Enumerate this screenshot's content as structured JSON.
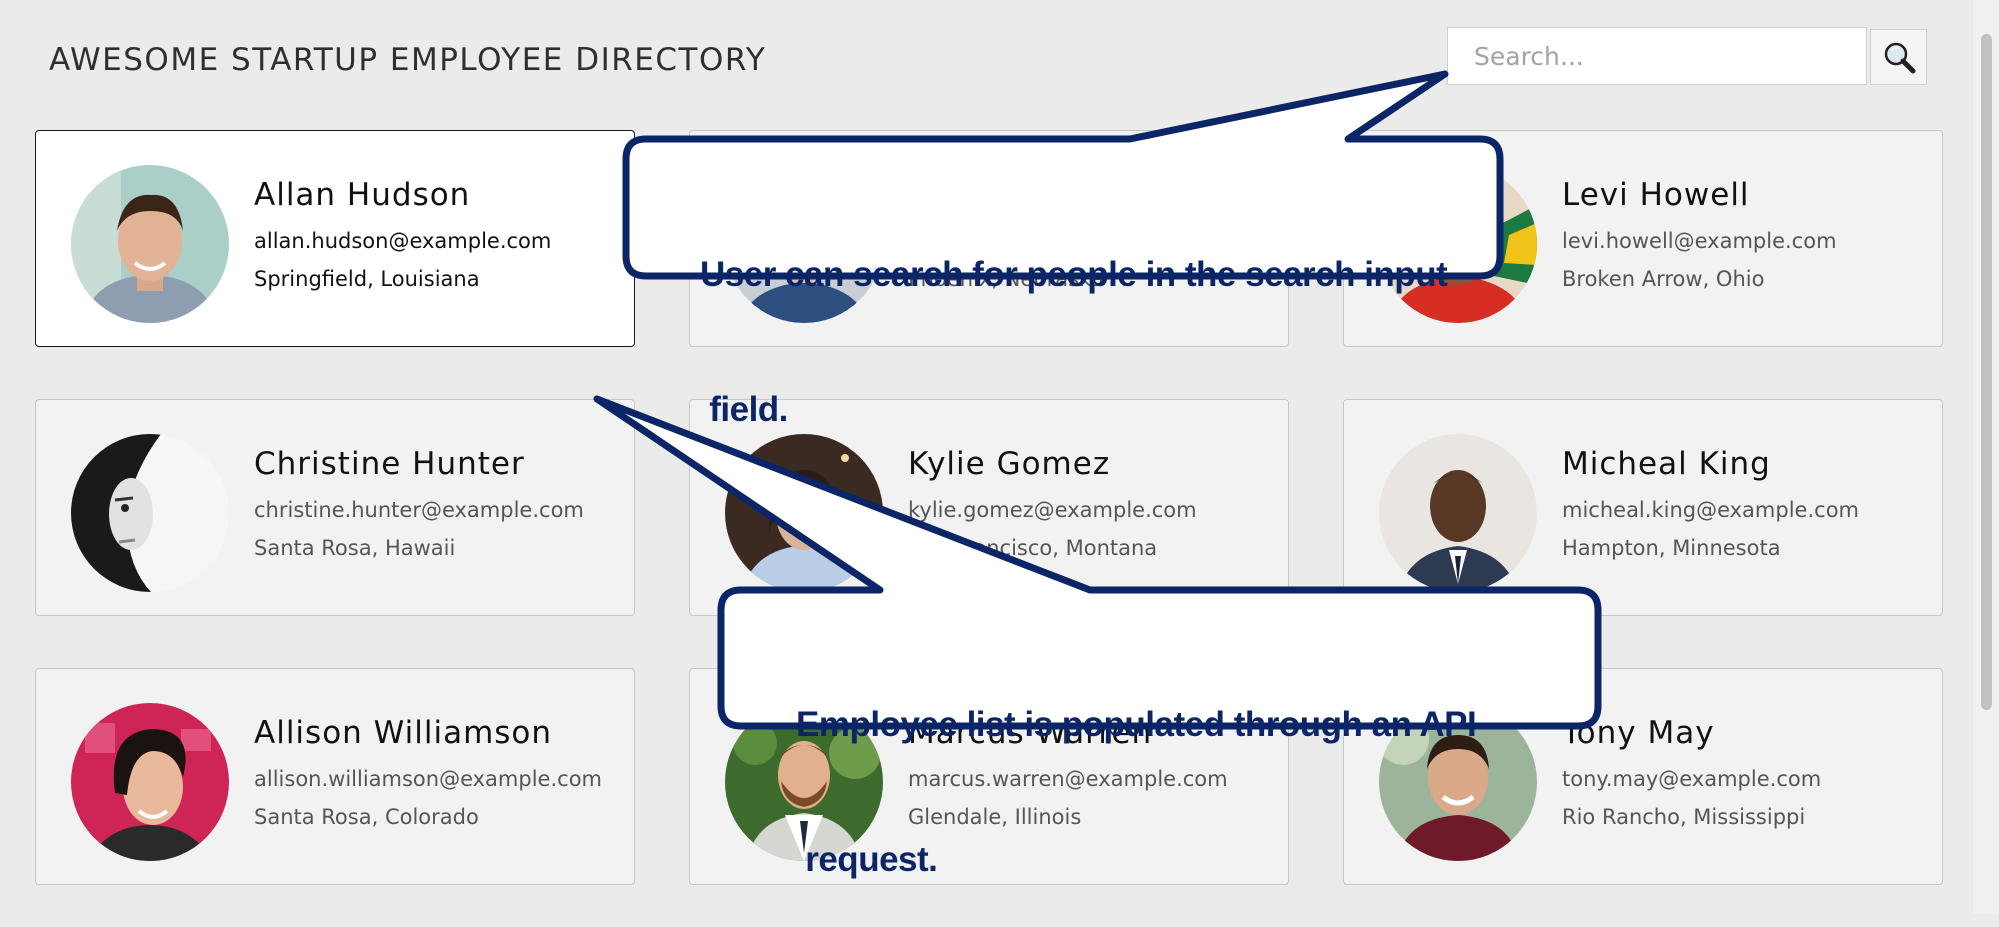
{
  "header": {
    "title": "AWESOME STARTUP EMPLOYEE DIRECTORY",
    "search_placeholder": "Search...",
    "search_icon": "magnifier-icon"
  },
  "employees": [
    {
      "name": "Allan Hudson",
      "email": "allan.hudson@example.com",
      "location": "Springfield, Louisiana"
    },
    {
      "name": "",
      "email": "",
      "location": "Phoenix, Nebraska"
    },
    {
      "name": "Levi Howell",
      "email": "levi.howell@example.com",
      "location": "Broken Arrow, Ohio"
    },
    {
      "name": "Christine Hunter",
      "email": "christine.hunter@example.com",
      "location": "Santa Rosa, Hawaii"
    },
    {
      "name": "Kylie Gomez",
      "email": "kylie.gomez@example.com",
      "location": "San Francisco, Montana"
    },
    {
      "name": "Micheal King",
      "email": "micheal.king@example.com",
      "location": "Hampton, Minnesota"
    },
    {
      "name": "Allison Williamson",
      "email": "allison.williamson@example.com",
      "location": "Santa Rosa, Colorado"
    },
    {
      "name": "Marcus Warren",
      "email": "marcus.warren@example.com",
      "location": "Glendale, Illinois"
    },
    {
      "name": "Tony May",
      "email": "tony.may@example.com",
      "location": "Rio Rancho, Mississippi"
    }
  ],
  "callouts": {
    "search": [
      "User can search for people in the search input",
      " field."
    ],
    "list": [
      "Employee list is populated through an API",
      " request."
    ]
  },
  "colors": {
    "callout_border": "#0b2566",
    "callout_text": "#0b2566",
    "active_border": "#1a1a1a"
  }
}
